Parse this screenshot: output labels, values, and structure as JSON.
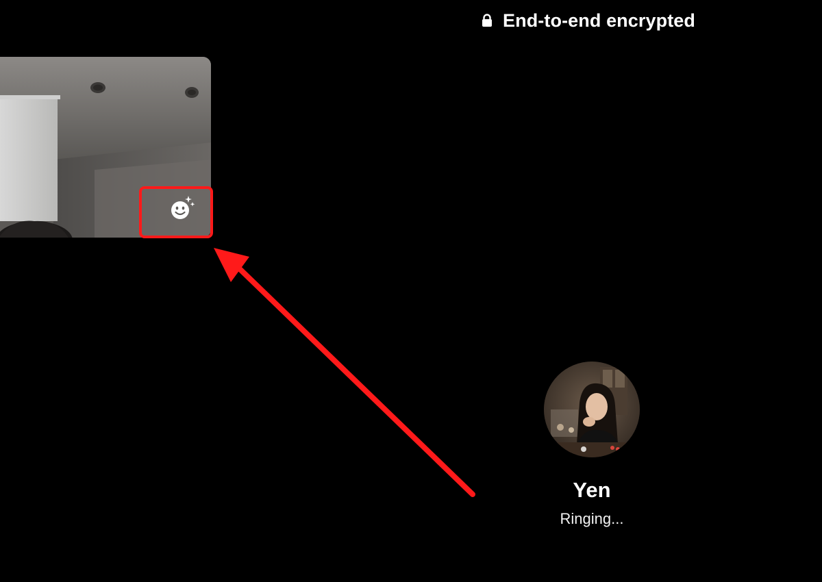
{
  "header": {
    "encryption_label": "End-to-end encrypted",
    "lock_icon": "lock-icon"
  },
  "self_preview": {
    "effects_icon": "face-sparkle-icon"
  },
  "callee": {
    "name": "Yen",
    "status": "Ringing..."
  },
  "annotation": {
    "color": "#ff1a1a"
  }
}
